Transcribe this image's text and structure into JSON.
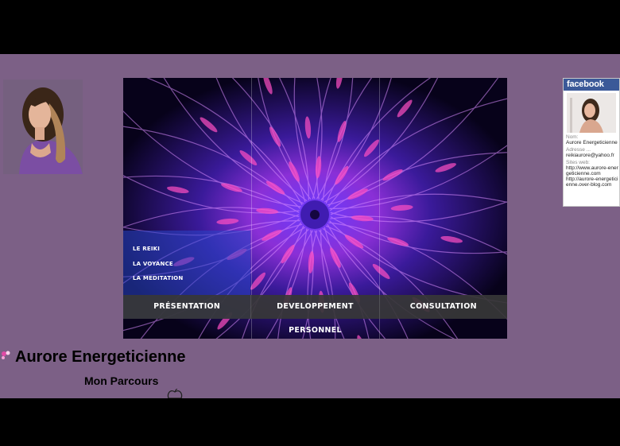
{
  "banner": {
    "side_menu": [
      "LE REIKI",
      "LA VOYANCE",
      "LA MEDITATION"
    ],
    "nav": [
      "PRÉSENTATION",
      "DEVELOPPEMENT PERSONNEL",
      "CONSULTATION"
    ]
  },
  "facebook_badge": {
    "brand": "facebook",
    "name_label": "Nom:",
    "name_value": "Aurore Energeticienne",
    "address_label": "Adresse ...",
    "address_value": "reikiaurore@yahoo.fr",
    "sites_label": "Sites web:",
    "site_1": "http://www.aurore-energeticienne.com",
    "site_2": "http://aurore-energeticienne.over-blog.com"
  },
  "content": {
    "site_title": "Aurore Energeticienne",
    "section_title": "Mon Parcours"
  },
  "colors": {
    "page_background": "#7c6086",
    "letterbox": "#000000",
    "nav_bar": "#373737",
    "facebook_blue": "#3b5998"
  }
}
